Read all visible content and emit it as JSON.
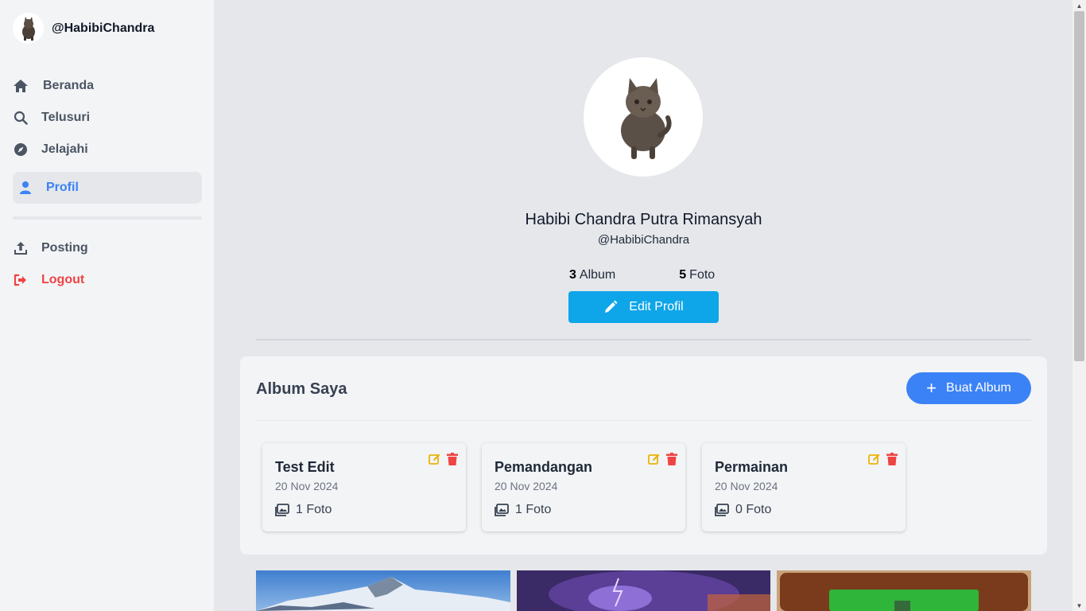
{
  "user": {
    "handle": "@HabibiChandra",
    "full_name": "Habibi Chandra Putra Rimansyah"
  },
  "sidebar": {
    "items": [
      {
        "label": "Beranda",
        "icon": "home-icon"
      },
      {
        "label": "Telusuri",
        "icon": "search-icon"
      },
      {
        "label": "Jelajahi",
        "icon": "compass-icon"
      },
      {
        "label": "Profil",
        "icon": "user-icon",
        "active": true
      },
      {
        "label": "Posting",
        "icon": "upload-icon"
      },
      {
        "label": "Logout",
        "icon": "logout-icon"
      }
    ]
  },
  "profile": {
    "album_count": "3",
    "album_label": "Album",
    "photo_count": "5",
    "photo_label": "Foto",
    "edit_button": "Edit Profil"
  },
  "albums_section": {
    "title": "Album Saya",
    "create_button": "Buat Album",
    "albums": [
      {
        "name": "Test Edit",
        "date": "20 Nov 2024",
        "count": "1 Foto"
      },
      {
        "name": "Pemandangan",
        "date": "20 Nov 2024",
        "count": "1 Foto"
      },
      {
        "name": "Permainan",
        "date": "20 Nov 2024",
        "count": "0 Foto"
      }
    ]
  },
  "photos": [
    {
      "subject": "snowy mountain"
    },
    {
      "subject": "purple storm"
    },
    {
      "subject": "green game board"
    }
  ],
  "colors": {
    "accent": "#3b82f6",
    "edit_button": "#0ea5e9",
    "danger": "#ef4444",
    "warning": "#eab308"
  }
}
